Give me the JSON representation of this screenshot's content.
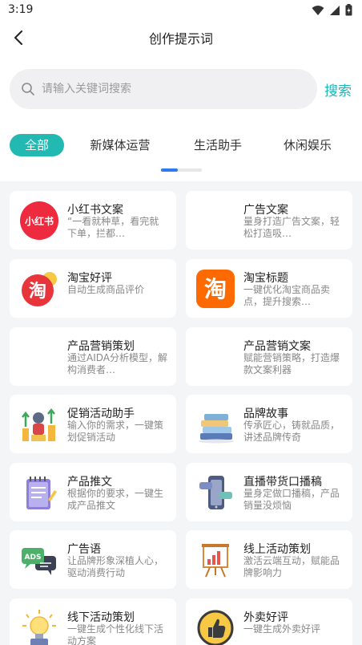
{
  "status": {
    "time": "3:19"
  },
  "header": {
    "title": "创作提示词"
  },
  "search": {
    "placeholder": "请输入关键词搜索",
    "button": "搜索"
  },
  "tabs": [
    {
      "label": "全部",
      "active": true
    },
    {
      "label": "新媒体运营"
    },
    {
      "label": "生活助手"
    },
    {
      "label": "休闲娱乐"
    }
  ],
  "cards": [
    {
      "title": "小红书文案",
      "desc": "“一看就种草，看完就下单，拦都…",
      "icon": "xiaohongshu-logo"
    },
    {
      "title": "广告文案",
      "desc": "量身打造广告文案，轻松打造吸…",
      "icon": "none"
    },
    {
      "title": "淘宝好评",
      "desc": "自动生成商品评价",
      "icon": "taobao-red-icon"
    },
    {
      "title": "淘宝标题",
      "desc": "一键优化淘宝商品卖点，提升搜索…",
      "icon": "taobao-orange-icon"
    },
    {
      "title": "产品营销策划",
      "desc": "通过AIDA分析模型，解构消费者…",
      "icon": "none"
    },
    {
      "title": "产品营销文案",
      "desc": "赋能营销策略，打造爆款文案利器",
      "icon": "none"
    },
    {
      "title": "促销活动助手",
      "desc": "输入你的需求，一键策划促销活动",
      "icon": "promotion-icon"
    },
    {
      "title": "品牌故事",
      "desc": "传承匠心，铸就品质，讲述品牌传奇",
      "icon": "books-icon"
    },
    {
      "title": "产品推文",
      "desc": "根据你的要求，一键生成产品推文",
      "icon": "notepad-icon"
    },
    {
      "title": "直播带货口播稿",
      "desc": "量身定做口播稿，产品销量没烦恼",
      "icon": "live-phone-icon"
    },
    {
      "title": "广告语",
      "desc": "让品牌形象深植人心，驱动消费行动",
      "icon": "ads-icon"
    },
    {
      "title": "线上活动策划",
      "desc": "激活云端互动，赋能品牌影响力",
      "icon": "presentation-icon"
    },
    {
      "title": "线下活动策划",
      "desc": "一键生成个性化线下活动方案",
      "icon": "lightbulb-icon"
    },
    {
      "title": "外卖好评",
      "desc": "一键生成外卖好评",
      "icon": "thumbs-up-icon"
    }
  ]
}
